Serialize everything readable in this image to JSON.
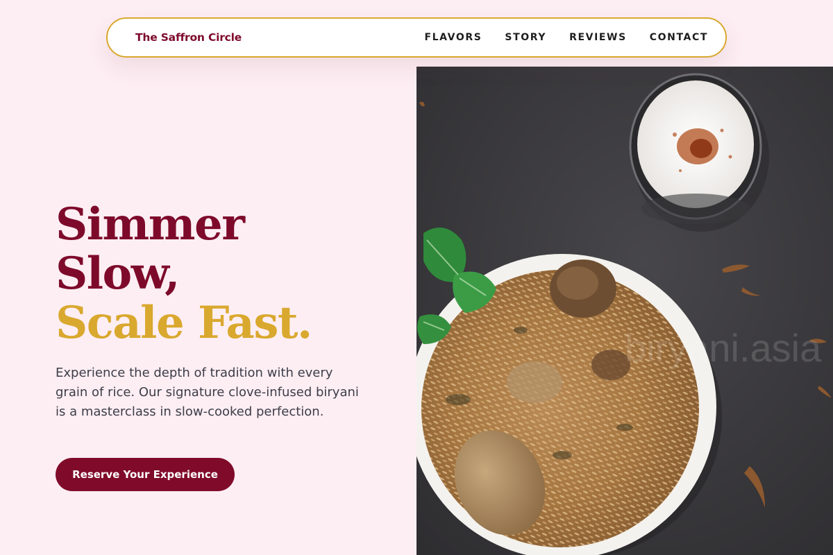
{
  "nav": {
    "brand": "The Saffron Circle",
    "links": [
      "FLAVORS",
      "STORY",
      "REVIEWS",
      "CONTACT"
    ]
  },
  "hero": {
    "title_line1": "Simmer",
    "title_line2": "Slow,",
    "title_line3": "Scale Fast.",
    "description": "Experience the depth of tradition with every grain of rice. Our signature clove-infused biryani is a masterclass in slow-cooked perfection.",
    "cta_label": "Reserve Your Experience",
    "image_watermark": "biryani.asia"
  },
  "colors": {
    "background": "#fdeef3",
    "brand": "#7e0a2b",
    "accent_gold": "#d9a82e",
    "body_text": "#3c3d48",
    "button": "#800a2a"
  },
  "icons": [
    "biryani-bowl-image",
    "raita-glass-image",
    "mint-garnish"
  ]
}
